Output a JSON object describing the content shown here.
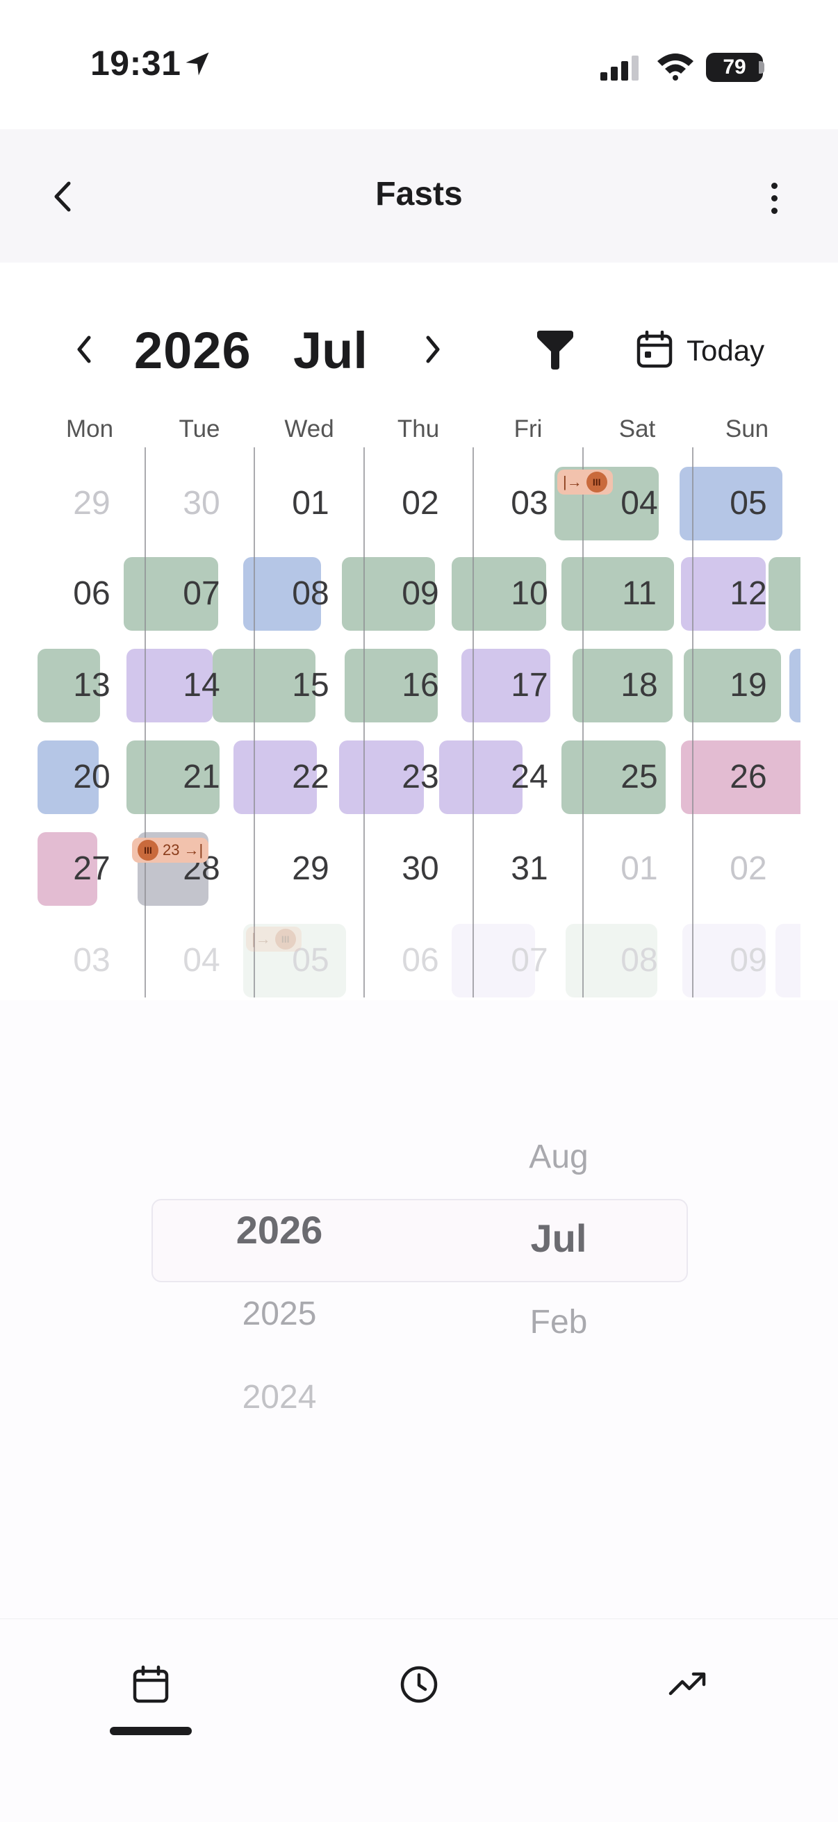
{
  "status": {
    "time": "19:31",
    "battery": "79"
  },
  "header": {
    "title": "Fasts"
  },
  "calendar": {
    "year": "2026",
    "month": "Jul",
    "today_label": "Today",
    "weekdays": [
      "Mon",
      "Tue",
      "Wed",
      "Thu",
      "Fri",
      "Sat",
      "Sun"
    ],
    "weeks": [
      [
        "29",
        "30",
        "01",
        "02",
        "03",
        "04",
        "05"
      ],
      [
        "06",
        "07",
        "08",
        "09",
        "10",
        "11",
        "12"
      ],
      [
        "13",
        "14",
        "15",
        "16",
        "17",
        "18",
        "19"
      ],
      [
        "20",
        "21",
        "22",
        "23",
        "24",
        "25",
        "26"
      ],
      [
        "27",
        "28",
        "29",
        "30",
        "31",
        "01",
        "02"
      ],
      [
        "03",
        "04",
        "05",
        "06",
        "07",
        "08",
        "09"
      ]
    ],
    "badge_28": "23"
  },
  "picker": {
    "years": [
      "2026",
      "2025",
      "2024"
    ],
    "months": [
      "Aug",
      "Jul",
      "Feb"
    ]
  },
  "tabs": [
    "calendar-icon",
    "clock-icon",
    "trend-icon"
  ]
}
